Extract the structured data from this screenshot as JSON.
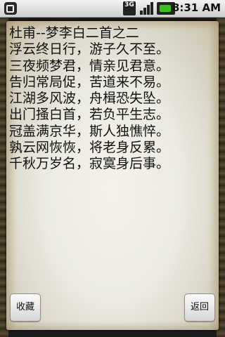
{
  "status_bar": {
    "network_label": "3G",
    "time": "8:31 AM",
    "icons": [
      "notification-icon",
      "network-3g-icon",
      "signal-icon",
      "battery-icon"
    ]
  },
  "poem": {
    "title": "杜甫--梦李白二首之二",
    "lines": [
      "浮云终日行，游子久不至。",
      "三夜频梦君，情亲见君意。",
      "告归常局促，苦道来不易。",
      "江湖多风波，舟楫恐失坠。",
      "出门搔白首，若负平生志。",
      "冠盖满京华，斯人独憔悴。",
      "孰云网恢恢，将老身反累。",
      "千秋万岁名，寂寞身后事。"
    ]
  },
  "buttons": {
    "collect": "收藏",
    "back": "返回"
  },
  "colors": {
    "battery": "#39c21c",
    "text": "#111111"
  }
}
